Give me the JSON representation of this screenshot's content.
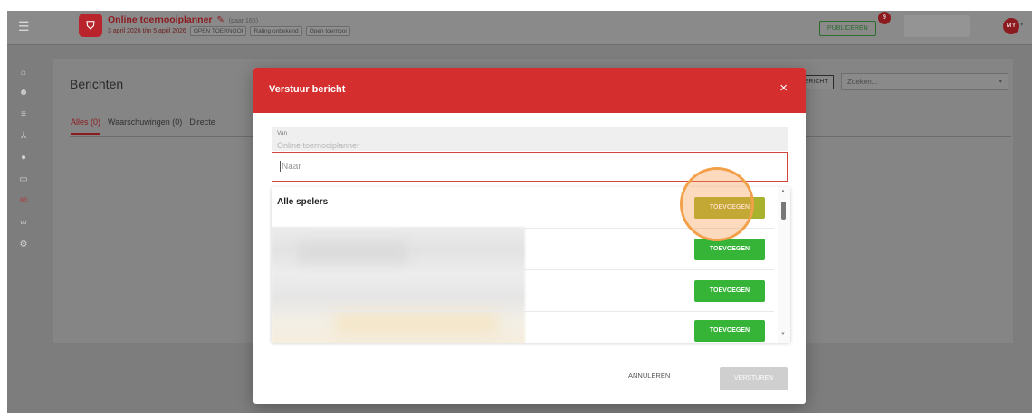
{
  "banner": {
    "fragments": [
      "",
      "",
      ""
    ]
  },
  "header": {
    "menu_icon": "hamburger-icon",
    "logo_icon": "shield-icon",
    "title": "Online toernooiplanner",
    "title_suffix": "(paar 165)",
    "dates": "3 april 2026 t/m 5 april 2026",
    "tags": [
      "OPEN TOERNOOI",
      "Rating onbekend",
      "Open toernooi"
    ],
    "publish_label": "PUBLICEREN",
    "badge_count": "9",
    "avatar_initials": "MY"
  },
  "sidebar": {
    "items": [
      {
        "icon": "home-icon",
        "glyph": "⌂"
      },
      {
        "icon": "users-icon",
        "glyph": "☻"
      },
      {
        "icon": "list-icon",
        "glyph": "≡"
      },
      {
        "icon": "hierarchy-icon",
        "glyph": "⅄"
      },
      {
        "icon": "globe-icon",
        "glyph": "●"
      },
      {
        "icon": "monitor-icon",
        "glyph": "▭"
      },
      {
        "icon": "mail-icon",
        "glyph": "✉"
      },
      {
        "icon": "link-icon",
        "glyph": "∞"
      },
      {
        "icon": "gear-icon",
        "glyph": "⚙"
      }
    ]
  },
  "page": {
    "title": "Berichten",
    "tabs": [
      "Alles (0)",
      "Waarschuwingen (0)",
      "Directe"
    ],
    "new_message_label": "BERICHT",
    "search_placeholder": "Zoeken..."
  },
  "modal": {
    "title": "Verstuur bericht",
    "close_glyph": "×",
    "from_label": "Van",
    "from_value": "Online toernooiplanner",
    "to_placeholder": "Naar",
    "rows": [
      {
        "name": "Alle spelers",
        "button": "TOEVOEGEN"
      },
      {
        "name": "",
        "button": "TOEVOEGEN"
      },
      {
        "name": "",
        "button": "TOEVOEGEN"
      },
      {
        "name": "",
        "button": "TOEVOEGEN"
      }
    ],
    "cancel_label": "ANNULEREN",
    "send_label": "VERSTUREN"
  },
  "colors": {
    "brand_red": "#d42e2e",
    "add_green": "#36b438",
    "highlight_ring": "#f2a14a"
  }
}
